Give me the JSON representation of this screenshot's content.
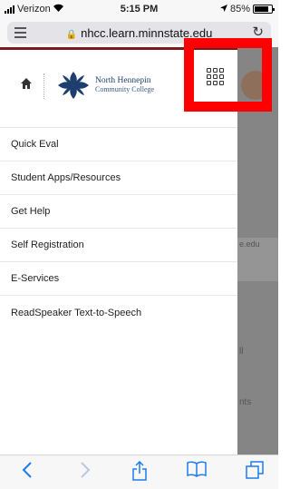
{
  "status_bar": {
    "carrier": "Verizon",
    "time": "5:15 PM",
    "battery_percent": "85%",
    "battery_level": 0.85
  },
  "browser": {
    "url": "nhcc.learn.minnstate.edu",
    "icons": {
      "reader": "reader-mode-icon",
      "lock": "lock-icon",
      "reload": "reload-icon"
    }
  },
  "header": {
    "logo_line1": "North Hennepin",
    "logo_line2": "Community College",
    "icons": {
      "home": "home-icon",
      "apps": "apps-grid-icon"
    }
  },
  "menu": {
    "items": [
      {
        "label": "Quick Eval"
      },
      {
        "label": "Student Apps/Resources"
      },
      {
        "label": "Get Help"
      },
      {
        "label": "Self Registration"
      },
      {
        "label": "E-Services"
      },
      {
        "label": "ReadSpeaker Text-to-Speech"
      }
    ]
  },
  "background_page": {
    "fragments": [
      "e.edu",
      "ll",
      "nts"
    ]
  },
  "colors": {
    "highlight": "#ff0000",
    "brand_dark_red": "#7a1a1a",
    "logo_blue": "#1d3e6e",
    "ios_blue": "#1b7cf3"
  }
}
